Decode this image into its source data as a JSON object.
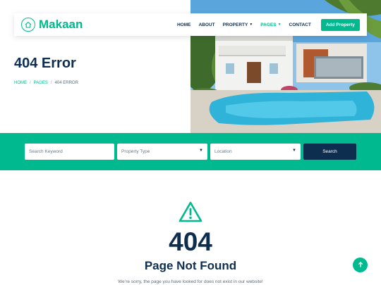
{
  "brand": {
    "name": "Makaan",
    "icon": "house-icon"
  },
  "nav": {
    "items": [
      {
        "label": "HOME",
        "dropdown": false,
        "active": false
      },
      {
        "label": "ABOUT",
        "dropdown": false,
        "active": false
      },
      {
        "label": "PROPERTY",
        "dropdown": true,
        "active": false
      },
      {
        "label": "PAGES",
        "dropdown": true,
        "active": true
      },
      {
        "label": "CONTACT",
        "dropdown": false,
        "active": false
      }
    ],
    "cta_label": "Add Property"
  },
  "hero": {
    "title": "404 Error",
    "breadcrumb": [
      {
        "label": "HOME",
        "link": true
      },
      {
        "label": "PAGES",
        "link": true
      },
      {
        "label": "404 ERROR",
        "link": false
      }
    ]
  },
  "search": {
    "keyword_placeholder": "Search Keyword",
    "property_type_label": "Property Type",
    "location_label": "Location",
    "button_label": "Search"
  },
  "error": {
    "icon": "warning-triangle-icon",
    "code": "404",
    "title": "Page Not Found",
    "message": "We’re sorry, the page you have looked for does not exist in our website!"
  },
  "colors": {
    "primary": "#00b98e",
    "dark": "#0e2e50"
  }
}
